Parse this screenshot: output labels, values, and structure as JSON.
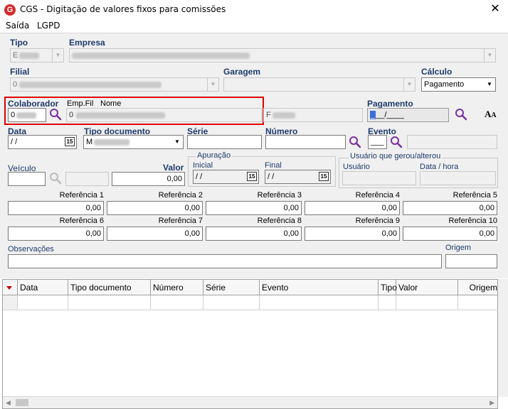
{
  "window": {
    "title": "CGS - Digitação de valores fixos para comissões",
    "icon": "G"
  },
  "menu": {
    "items": [
      "Saída",
      "LGPD"
    ]
  },
  "labels": {
    "tipo": "Tipo",
    "empresa": "Empresa",
    "filial": "Filial",
    "garagem": "Garagem",
    "calculo": "Cálculo",
    "colaborador": "Colaborador",
    "emp_fil": "Emp.Fil",
    "nome": "Nome",
    "pagamento": "Pagamento",
    "data": "Data",
    "tipo_documento": "Tipo documento",
    "serie": "Série",
    "numero": "Número",
    "evento": "Evento",
    "veiculo": "Veículo",
    "valor": "Valor",
    "apuracao": "Apuração",
    "inicial": "Inicial",
    "final": "Final",
    "usuario_group": "Usuário que gerou/alterou",
    "usuario": "Usuário",
    "data_hora": "Data / hora",
    "observacoes": "Observações",
    "origem": "Origem"
  },
  "fields": {
    "tipo_value": "E",
    "filial_value": "0",
    "calculo_value": "Pagamento",
    "colaborador_value": "0",
    "nome_value": "0",
    "pagamento_value": "__/____",
    "data_value": " / /",
    "tipo_documento_value": "M",
    "evento_value": "___",
    "valor_value": "0,00",
    "inicial_value": " / /",
    "final_value": " / /",
    "extra_text": "F"
  },
  "referencias": [
    {
      "label": "Referência 1",
      "value": "0,00"
    },
    {
      "label": "Referência 2",
      "value": "0,00"
    },
    {
      "label": "Referência 3",
      "value": "0,00"
    },
    {
      "label": "Referência 4",
      "value": "0,00"
    },
    {
      "label": "Referência 5",
      "value": "0,00"
    },
    {
      "label": "Referência 6",
      "value": "0,00"
    },
    {
      "label": "Referência 7",
      "value": "0,00"
    },
    {
      "label": "Referência 8",
      "value": "0,00"
    },
    {
      "label": "Referência 9",
      "value": "0,00"
    },
    {
      "label": "Referência 10",
      "value": "0,00"
    }
  ],
  "grid": {
    "columns": [
      "Data",
      "Tipo documento",
      "Número",
      "Série",
      "Evento",
      "Tipo",
      "Valor",
      "Origem"
    ]
  },
  "icons": {
    "search": "search-icon",
    "font": "font-size-icon",
    "calendar": "calendar-icon",
    "close": "close-icon"
  },
  "colors": {
    "label_blue": "#1e3a6e",
    "highlight_red": "#e00000",
    "search_purple": "#7b2fa0"
  }
}
